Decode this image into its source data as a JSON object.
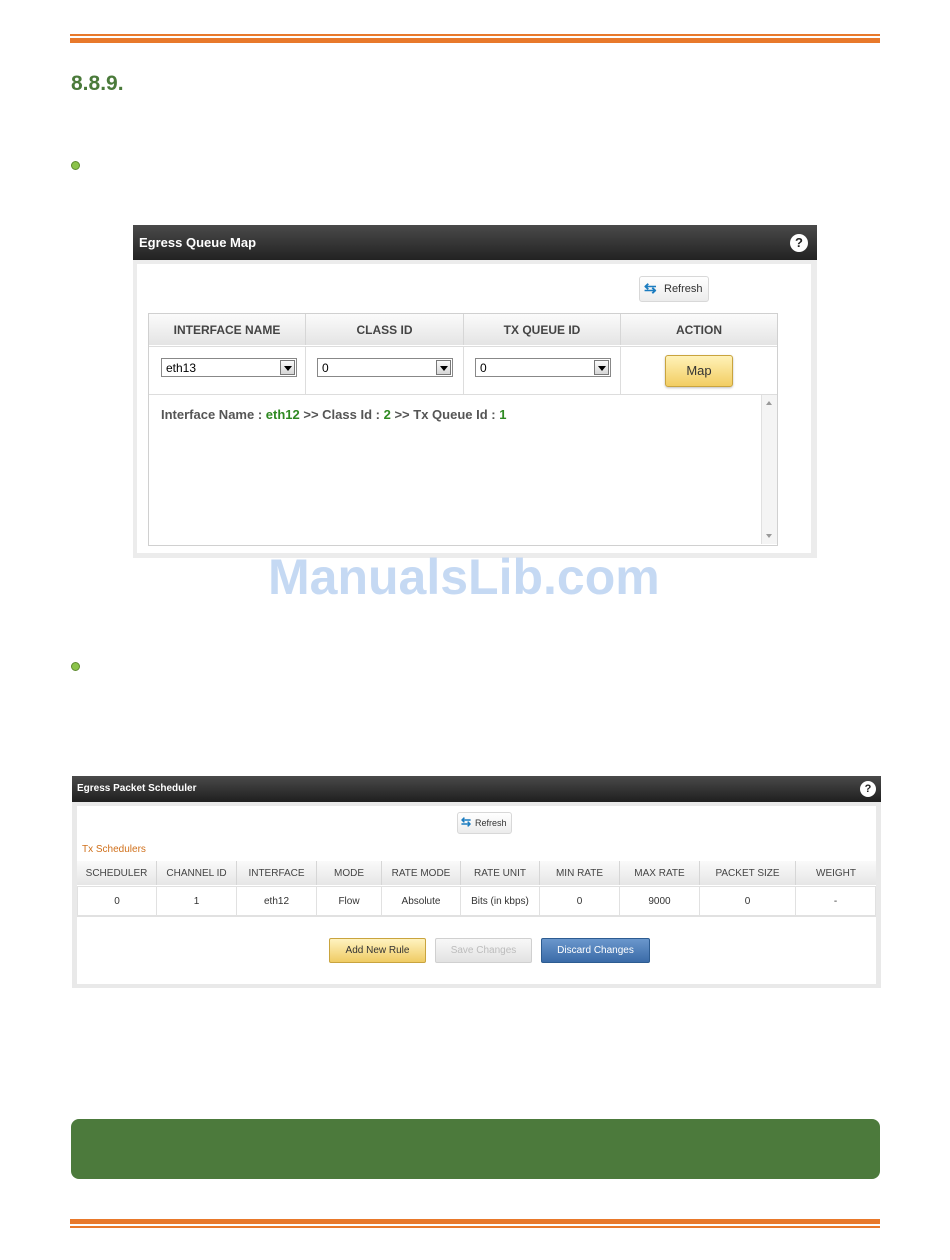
{
  "section": {
    "number": "8.8.9."
  },
  "egress_queue_map": {
    "title": "Egress Queue Map",
    "help": "?",
    "refresh_label": "Refresh",
    "columns": [
      "INTERFACE NAME",
      "CLASS ID",
      "TX QUEUE ID",
      "ACTION"
    ],
    "interface_select": "eth13",
    "class_select": "0",
    "tx_queue_select": "0",
    "map_label": "Map",
    "result": {
      "label_interface": "Interface Name :",
      "interface": "eth12",
      "label_class": ">> Class Id :",
      "class_id": "2",
      "label_tx": ">> Tx Queue Id :",
      "tx_queue": "1"
    }
  },
  "watermark": "ManualsLib.com",
  "egress_packet_scheduler": {
    "title": "Egress Packet Scheduler",
    "help": "?",
    "refresh_label": "Refresh",
    "section_label": "Tx Schedulers",
    "columns": [
      "SCHEDULER",
      "CHANNEL ID",
      "INTERFACE",
      "MODE",
      "RATE MODE",
      "RATE UNIT",
      "MIN RATE",
      "MAX RATE",
      "PACKET SIZE",
      "WEIGHT"
    ],
    "rows": [
      [
        "0",
        "1",
        "eth12",
        "Flow",
        "Absolute",
        "Bits (in kbps)",
        "0",
        "9000",
        "0",
        "-"
      ]
    ],
    "buttons": {
      "add": "Add New Rule",
      "save": "Save Changes",
      "discard": "Discard Changes"
    }
  },
  "colors": {
    "accent_rule": "#e8792b",
    "heading": "#4a7a3a",
    "note_box": "#4c7a3c"
  }
}
